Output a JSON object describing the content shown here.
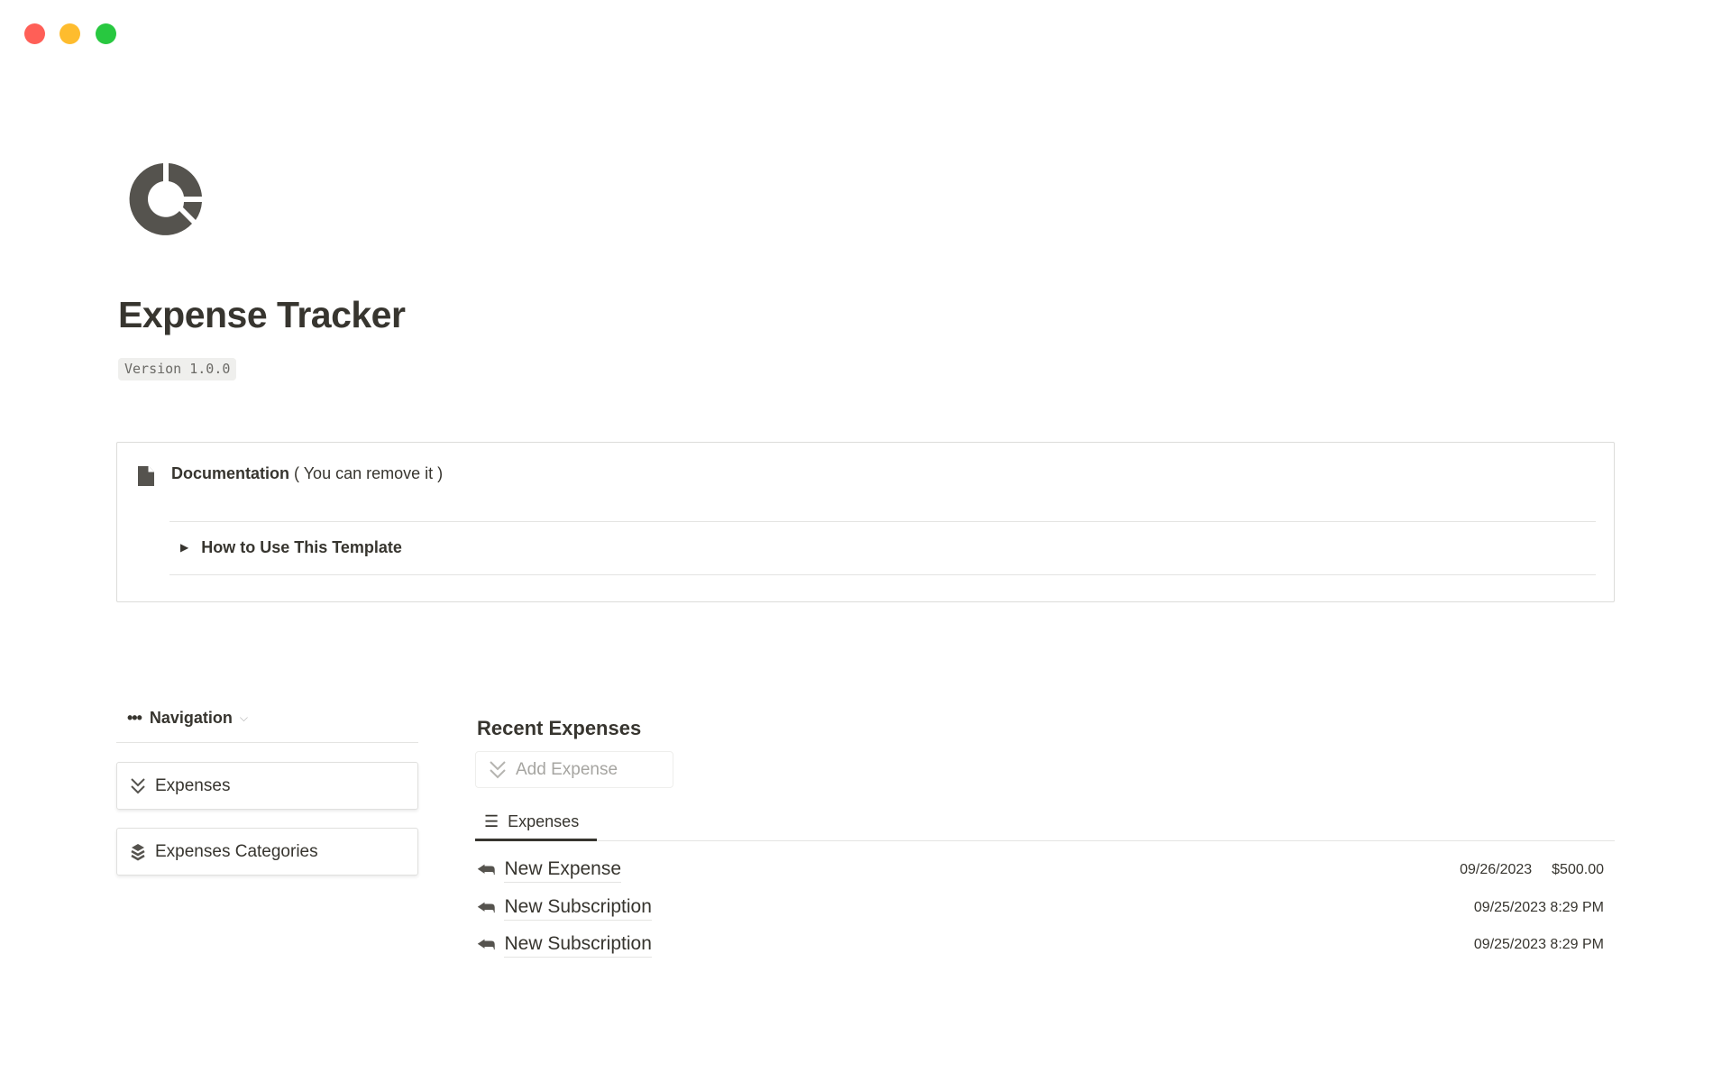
{
  "window": {
    "controls": {
      "close_color": "#ff5f57",
      "minimize_color": "#febc2e",
      "maximize_color": "#28c840"
    }
  },
  "page": {
    "icon": "donut-chart-icon",
    "title": "Expense Tracker",
    "version": "Version 1.0.0"
  },
  "documentation": {
    "icon": "document-icon",
    "title": "Documentation",
    "note": "( You can remove it )",
    "toggle": {
      "icon": "triangle-right-icon",
      "label": "How to Use This Template"
    }
  },
  "navigation": {
    "label": "Navigation",
    "items": [
      {
        "icon": "double-chevron-down-icon",
        "label": "Expenses"
      },
      {
        "icon": "layers-icon",
        "label": "Expenses Categories"
      }
    ]
  },
  "recent": {
    "heading": "Recent Expenses",
    "add_button": "Add Expense",
    "tab": "Expenses",
    "rows": [
      {
        "name": "New Expense",
        "date": "09/26/2023",
        "amount": "$500.00"
      },
      {
        "name": "New Subscription",
        "date": "09/25/2023 8:29 PM",
        "amount": ""
      },
      {
        "name": "New Subscription",
        "date": "09/25/2023 8:29 PM",
        "amount": ""
      }
    ]
  }
}
